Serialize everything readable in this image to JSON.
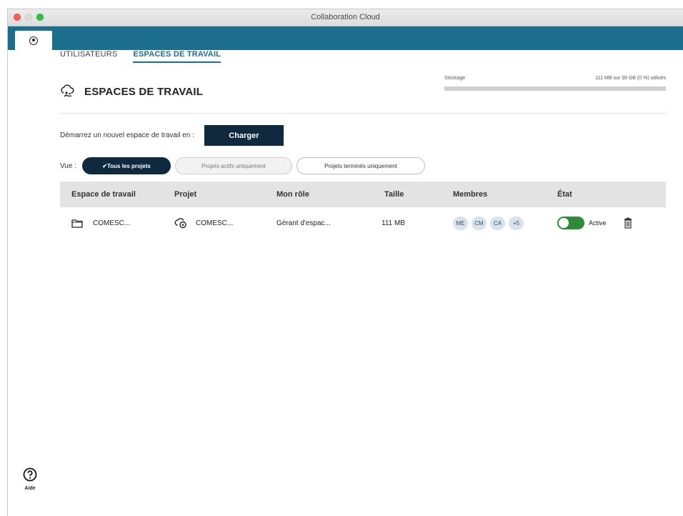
{
  "window": {
    "title": "Collaboration Cloud"
  },
  "subtabs": [
    {
      "label": "UTILISATEURS"
    },
    {
      "label": "ESPACES DE TRAVAIL"
    }
  ],
  "header": {
    "title": "ESPACES DE TRAVAIL",
    "storage_label": "Stockage",
    "storage_value": "111 MB sur 39 GB (0 %) utilisés",
    "storage_used_fraction": 0
  },
  "upload": {
    "text": "Démarrez un nouvel espace de travail en :",
    "button_label": "Charger"
  },
  "filters": {
    "label": "Vue :",
    "options": [
      {
        "label": "✔Tous les projets"
      },
      {
        "label": "Projets actifs uniquement"
      },
      {
        "label": "Projets terminés uniquement"
      }
    ]
  },
  "table": {
    "columns": [
      "Espace de travail",
      "Projet",
      "Mon rôle",
      "Taille",
      "Membres",
      "État"
    ],
    "rows": [
      {
        "workspace": "COMESC...",
        "project": "COMESC...",
        "role": "Gérant d'espac...",
        "size": "111 MB",
        "members": [
          "ME",
          "CM",
          "CA",
          "+5"
        ],
        "state": "Active"
      }
    ]
  },
  "help": {
    "label": "Aide"
  },
  "colors": {
    "accent": "#1c6e8d",
    "dark": "#0f2a3f",
    "toggle_on": "#2e8b37"
  },
  "icons": [
    "home-icon",
    "cloud-users-icon",
    "folder-icon",
    "cloud-project-icon",
    "trash-icon",
    "help-icon"
  ]
}
